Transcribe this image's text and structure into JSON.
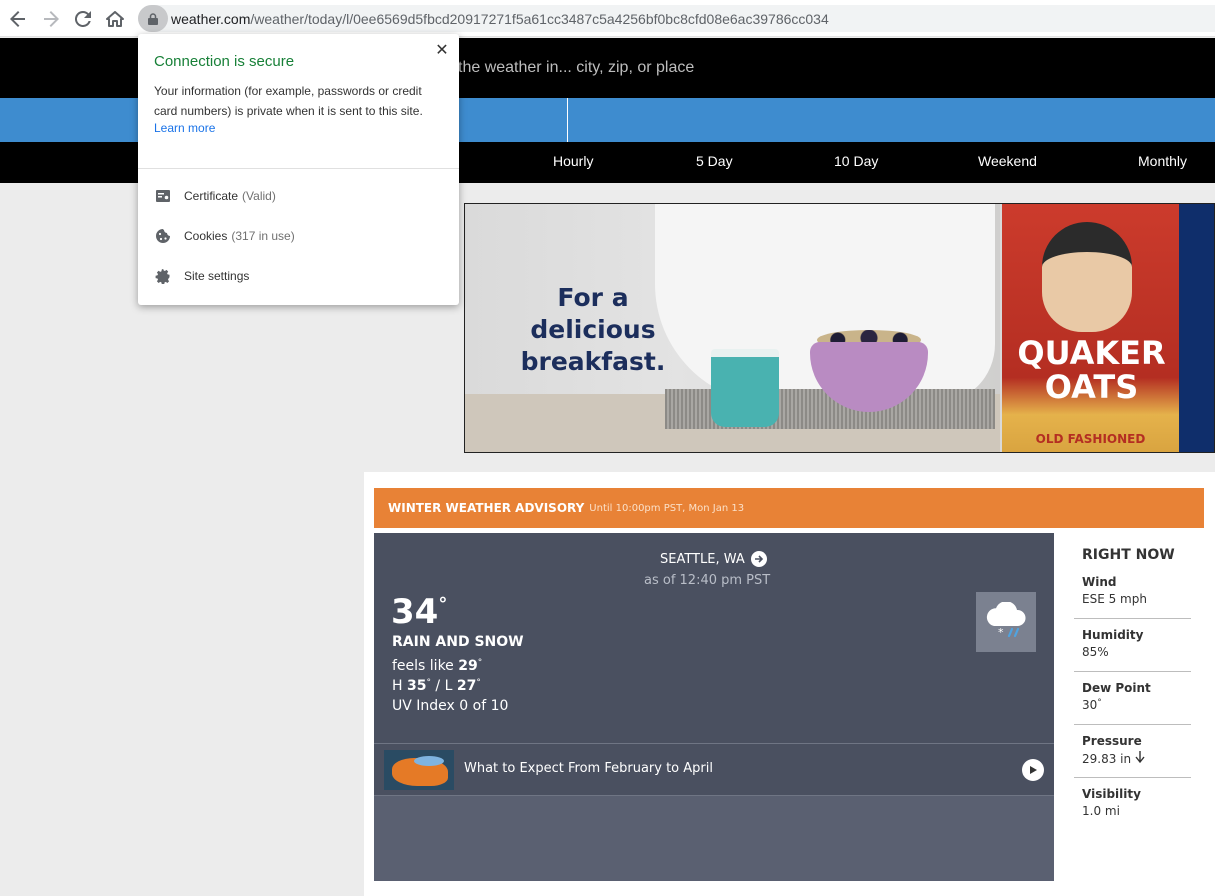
{
  "browser": {
    "url_host": "weather.com",
    "url_path": "/weather/today/l/0ee6569d5fbcd20917271f5a61cc3487c5a4256bf0bc8cfd08e6ac39786cc034"
  },
  "popup": {
    "title": "Connection is secure",
    "body": "Your information (for example, passwords or credit card numbers) is private when it is sent to this site.",
    "learn_more": "Learn more",
    "certificate_label": "Certificate",
    "certificate_meta": "(Valid)",
    "cookies_label": "Cookies",
    "cookies_meta": "(317 in use)",
    "site_settings_label": "Site settings"
  },
  "header": {
    "search_placeholder": "the weather in... city, zip, or place"
  },
  "nav": {
    "items": [
      "Hourly",
      "5 Day",
      "10 Day",
      "Weekend",
      "Monthly"
    ]
  },
  "ad": {
    "headline": "For a delicious breakfast.",
    "brand": "QUAKER OATS",
    "sub": "OLD FASHIONED"
  },
  "advisory": {
    "title": "WINTER WEATHER ADVISORY",
    "detail": "Until 10:00pm PST, Mon Jan 13"
  },
  "now": {
    "location": "SEATTLE, WA",
    "as_of": "as of 12:40 pm PST",
    "temp": "34",
    "deg": "°",
    "phrase": "RAIN AND SNOW",
    "feels_like_label": "feels like",
    "feels_like_value": "29",
    "high_label": "H",
    "high_value": "35",
    "low_label": "/ L",
    "low_value": "27",
    "uv": "UV Index 0 of 10"
  },
  "video": {
    "title": "What to Expect From February to April"
  },
  "right_now": {
    "title": "RIGHT NOW",
    "items": [
      {
        "label": "Wind",
        "value": "ESE 5 mph"
      },
      {
        "label": "Humidity",
        "value": "85%"
      },
      {
        "label": "Dew Point",
        "value": "30"
      },
      {
        "label": "Pressure",
        "value": "29.83 in"
      },
      {
        "label": "Visibility",
        "value": "1.0 mi"
      }
    ]
  },
  "colors": {
    "advisory": "#e88236",
    "card": "#4a5060",
    "blue_bar": "#3e8ccf",
    "secure_green": "#188038"
  }
}
